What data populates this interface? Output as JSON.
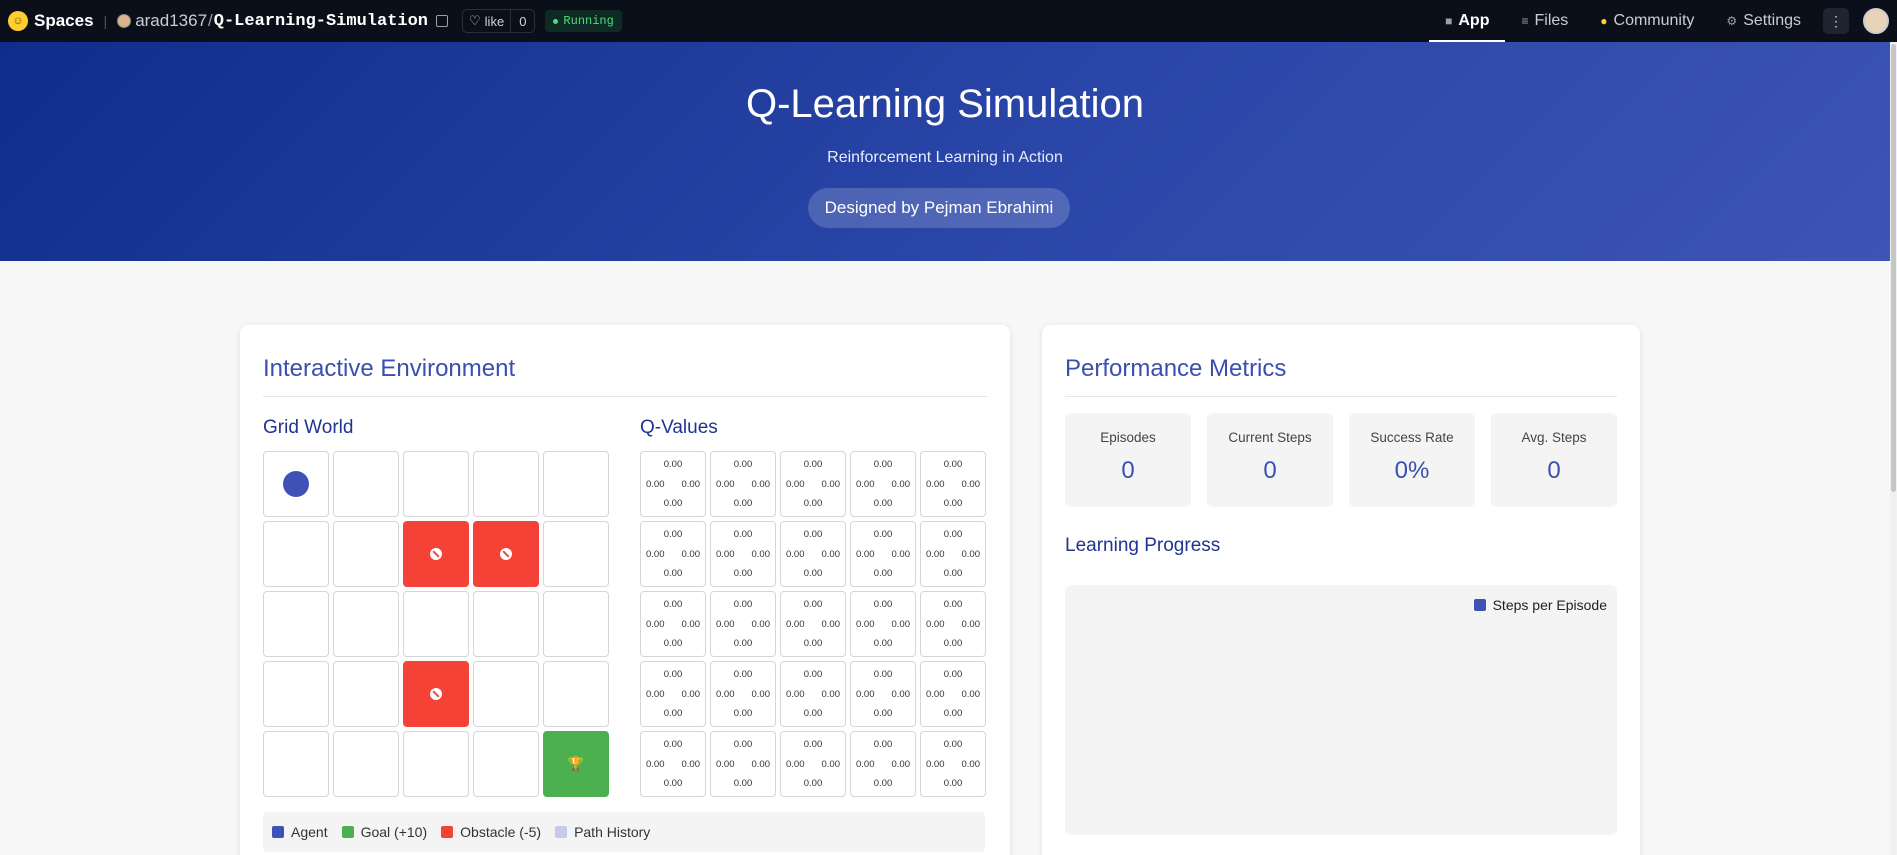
{
  "topbar": {
    "brand": "Spaces",
    "owner": "arad1367",
    "slash": "/",
    "repo": "Q-Learning-Simulation",
    "like_label": "like",
    "like_count": "0",
    "status": "Running",
    "nav": [
      {
        "label": "App",
        "icon": "cube-icon"
      },
      {
        "label": "Files",
        "icon": "files-icon"
      },
      {
        "label": "Community",
        "icon": "community-icon"
      },
      {
        "label": "Settings",
        "icon": "gear-icon"
      }
    ]
  },
  "hero": {
    "title": "Q-Learning Simulation",
    "subtitle": "Reinforcement Learning in Action",
    "badge": "Designed by Pejman Ebrahimi"
  },
  "environment": {
    "title": "Interactive Environment",
    "grid_title": "Grid World",
    "q_title": "Q-Values",
    "grid": [
      [
        "agent",
        "empty",
        "empty",
        "empty",
        "empty"
      ],
      [
        "empty",
        "empty",
        "obstacle",
        "obstacle",
        "empty"
      ],
      [
        "empty",
        "empty",
        "empty",
        "empty",
        "empty"
      ],
      [
        "empty",
        "empty",
        "obstacle",
        "empty",
        "empty"
      ],
      [
        "empty",
        "empty",
        "empty",
        "empty",
        "goal"
      ]
    ],
    "q_value": "0.00",
    "legend": [
      {
        "label": "Agent",
        "color": "#3f51b5"
      },
      {
        "label": "Goal (+10)",
        "color": "#4caf50"
      },
      {
        "label": "Obstacle (-5)",
        "color": "#f44336"
      },
      {
        "label": "Path History",
        "color": "#c5cae9"
      }
    ]
  },
  "metrics": {
    "title": "Performance Metrics",
    "items": [
      {
        "label": "Episodes",
        "value": "0"
      },
      {
        "label": "Current Steps",
        "value": "0"
      },
      {
        "label": "Success Rate",
        "value": "0%"
      },
      {
        "label": "Avg. Steps",
        "value": "0"
      }
    ],
    "progress_title": "Learning Progress",
    "chart_legend": "Steps per Episode"
  },
  "colors": {
    "accent": "#3f51b5",
    "goal": "#4caf50",
    "obstacle": "#f44336",
    "hero_start": "#0f2d8c",
    "hero_end": "#3d55b4"
  }
}
